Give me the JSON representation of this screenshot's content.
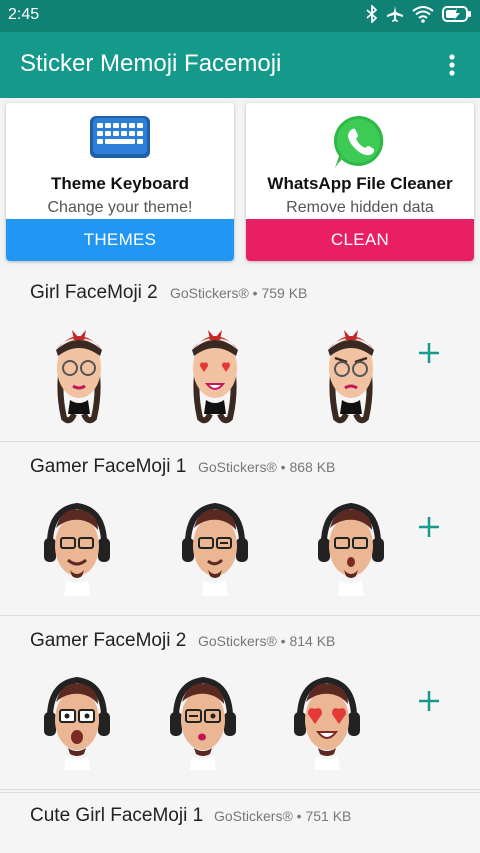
{
  "status_bar": {
    "time": "2:45",
    "icons": [
      "bluetooth-icon",
      "airplane-mode-icon",
      "wifi-icon",
      "battery-charging-icon"
    ]
  },
  "app_bar": {
    "title": "Sticker Memoji Facemoji",
    "menu_icon": "more-vertical-icon"
  },
  "promos": [
    {
      "title": "Theme Keyboard",
      "subtitle": "Change your theme!",
      "button": "THEMES",
      "icon": "keyboard-icon",
      "button_color": "#2196f3"
    },
    {
      "title": "WhatsApp File Cleaner",
      "subtitle": "Remove hidden data",
      "button": "CLEAN",
      "icon": "whatsapp-icon",
      "button_color": "#e91e63"
    }
  ],
  "packs": [
    {
      "name": "Girl FaceMoji 2",
      "publisher": "GoStickers®",
      "size": "759 KB",
      "stickers": [
        "girl-memoji-glasses-sticker",
        "girl-memoji-heart-eyes-sticker",
        "girl-memoji-angry-sticker"
      ]
    },
    {
      "name": "Gamer FaceMoji 1",
      "publisher": "GoStickers®",
      "size": "868 KB",
      "stickers": [
        "gamer-memoji-smile-sticker",
        "gamer-memoji-wink-sticker",
        "gamer-memoji-surprised-sticker"
      ]
    },
    {
      "name": "Gamer FaceMoji 2",
      "publisher": "GoStickers®",
      "size": "814 KB",
      "stickers": [
        "gamer-memoji-shocked-sticker",
        "gamer-memoji-kiss-sticker",
        "gamer-memoji-heart-eyes-sticker"
      ]
    },
    {
      "name": "Cute Girl FaceMoji 1",
      "publisher": "GoStickers®",
      "size": "751 KB"
    }
  ],
  "separator": "•",
  "colors": {
    "status_bar": "#0f8275",
    "app_bar": "#14998a",
    "add_icon": "#14998a",
    "themes_button": "#2196f3",
    "clean_button": "#e91e63"
  }
}
